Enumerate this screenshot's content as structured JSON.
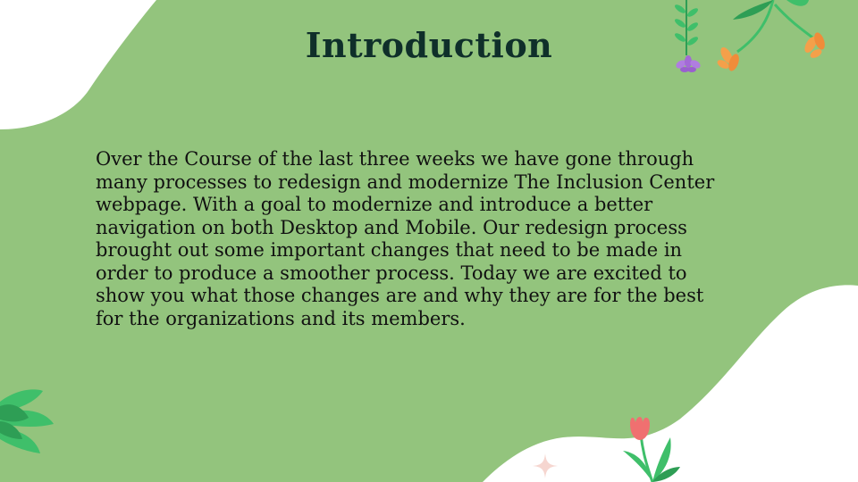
{
  "slide": {
    "title": "Introduction",
    "body": "Over the Course of the last three weeks we have gone through\nmany processes to redesign and modernize The Inclusion Center\nwebpage. With a goal to modernize and introduce a better\nnavigation on both Desktop and Mobile. Our redesign process\nbrought out some important changes that need to be made in\norder to produce a smoother process. Today we are excited to\nshow you what those changes are and why they are for the best\nfor the organizations and its members."
  },
  "colors": {
    "background": "#93c47d",
    "blob": "#ffffff",
    "title": "#0f2f2a",
    "text": "#111111",
    "leaf_green": "#3fbf6a",
    "leaf_dark": "#2e9e55",
    "flower_orange": "#f4a04a",
    "flower_purple": "#b07de0",
    "flower_pink": "#f07070"
  },
  "icons": [
    "hanging-vine-icon",
    "orange-flower-icon",
    "purple-flower-icon",
    "leaf-cluster-icon",
    "pink-tulip-icon",
    "sparkle-icon"
  ]
}
